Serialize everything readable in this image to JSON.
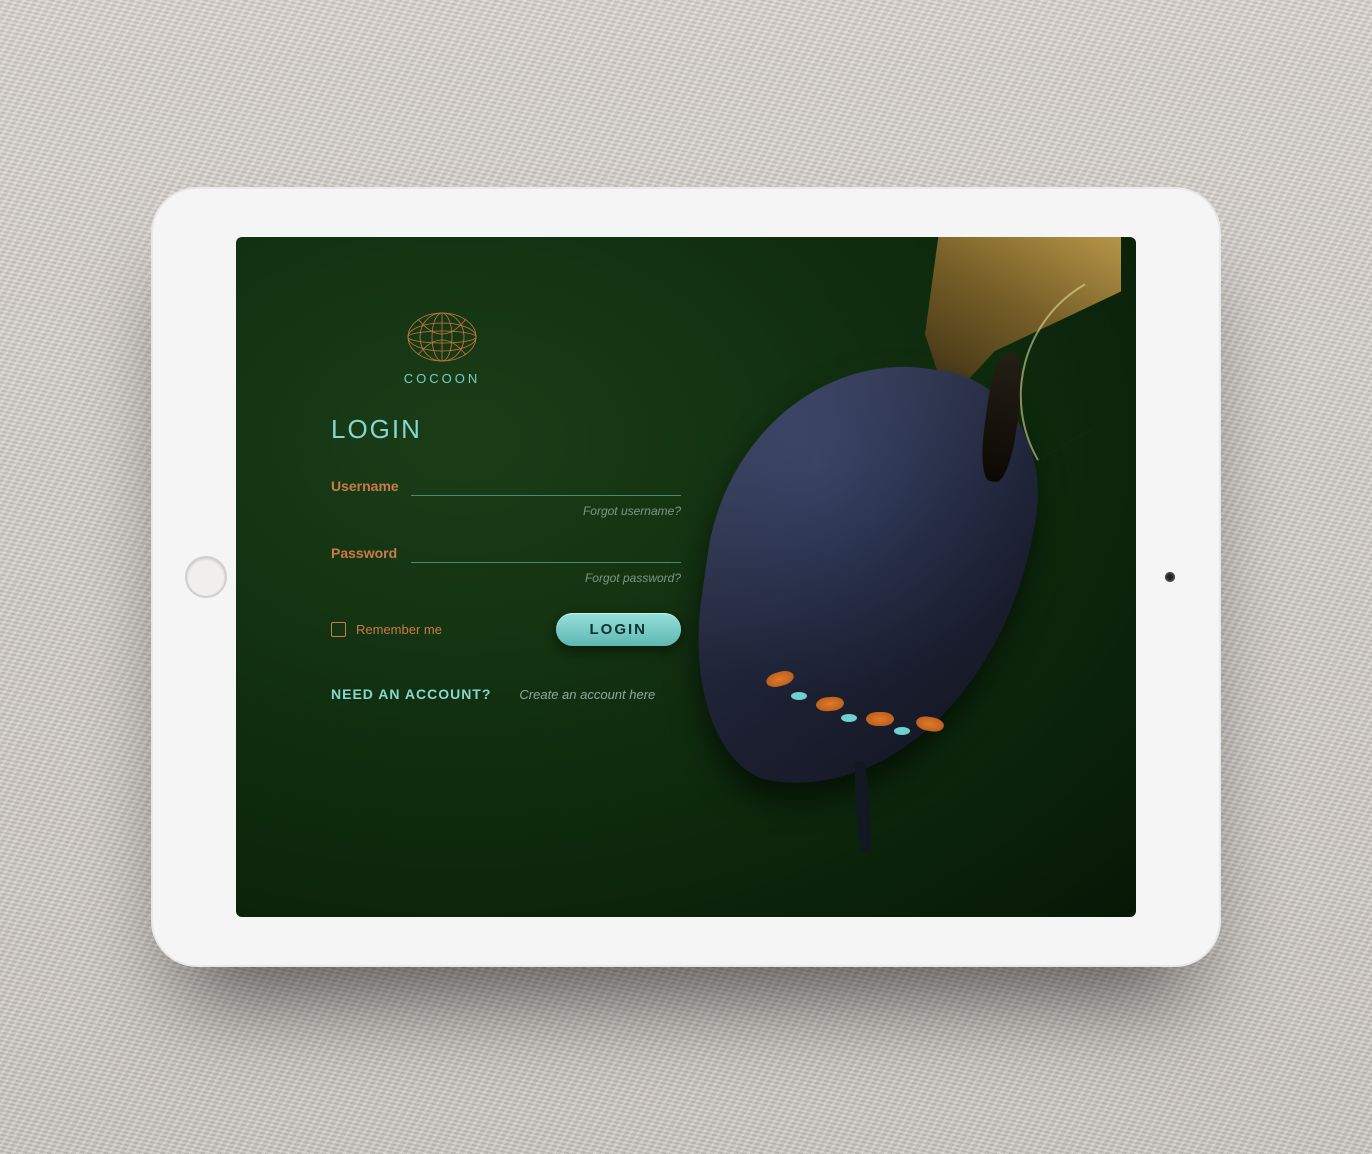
{
  "brand": {
    "name": "COCOON"
  },
  "login": {
    "heading": "LOGIN",
    "username": {
      "label": "Username",
      "value": "",
      "forgot": "Forgot username?"
    },
    "password": {
      "label": "Password",
      "value": "",
      "forgot": "Forgot password?"
    },
    "remember": {
      "label": "Remember me",
      "checked": false
    },
    "button": "LOGIN"
  },
  "signup": {
    "prompt": "NEED AN ACCOUNT?",
    "link": "Create an account here"
  },
  "colors": {
    "accent_teal": "#87d7cf",
    "accent_orange": "#cc7a49",
    "button_bg": "#7ccfca"
  }
}
